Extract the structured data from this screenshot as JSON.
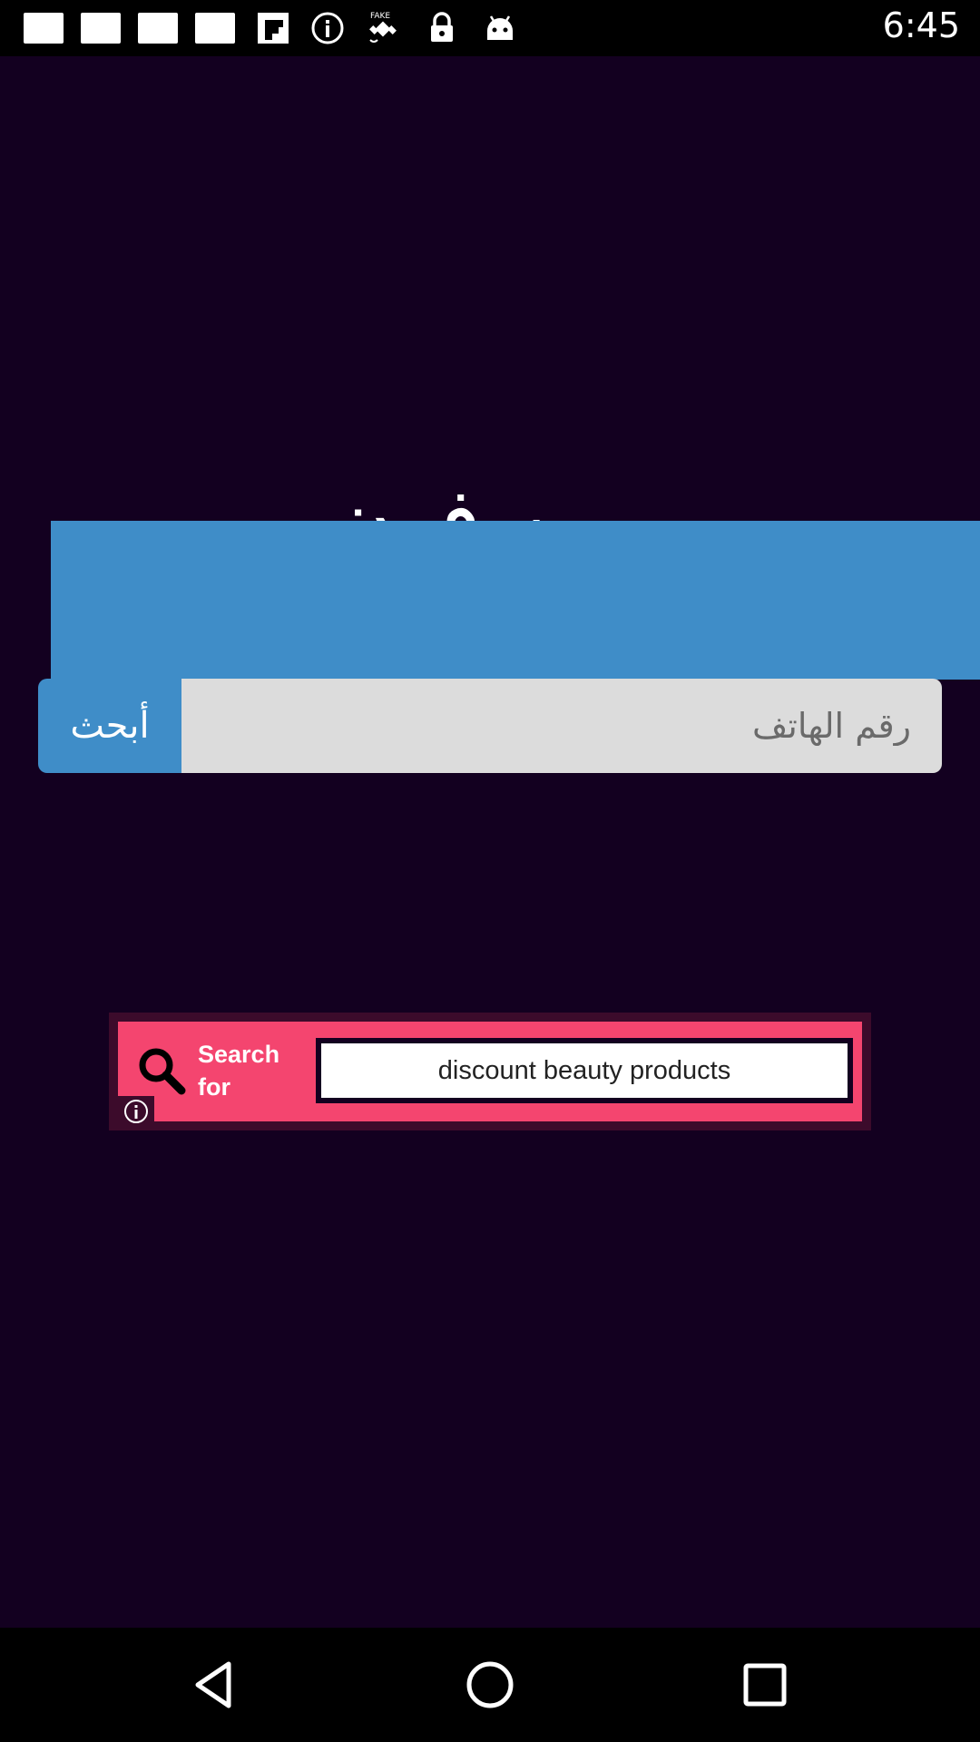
{
  "status_bar": {
    "time": "6:45",
    "icons": [
      "notification-square-icon",
      "notification-square-icon",
      "notification-square-icon",
      "notification-square-icon",
      "flipboard-icon",
      "info-circle-icon",
      "fake-gps-icon",
      "lock-icon",
      "android-icon"
    ]
  },
  "app": {
    "title": "يمن فون",
    "phone_input": {
      "placeholder": "رقم الهاتف",
      "value": ""
    },
    "search_button_label": "أبحث",
    "colors": {
      "background": "#130020",
      "accent": "#3f8dc8",
      "input": "#dcdcdc"
    }
  },
  "ad": {
    "label": "Search for",
    "query": "discount beauty products",
    "colors": {
      "background": "#f4456f",
      "border": "#3c0b2b"
    }
  },
  "nav_bar": {
    "buttons": [
      "back-icon",
      "home-icon",
      "recents-icon"
    ]
  }
}
